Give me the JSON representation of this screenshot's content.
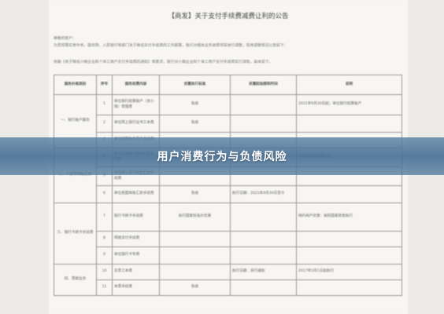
{
  "banner": {
    "text": "用户消费行为与负债风险"
  },
  "document": {
    "title": "【商发】关于支付手续费减费让利的公告",
    "paragraphs": [
      "尊敬的客户：",
      "为贯彻落实党中央、国务院、人民银行等部门关于降低支付手续费的工作部署，我行对相关业务收费项目进行调整，现将调整情况公告如下：",
      "依据《关于降低小微企业和个体工商户支付手续费的通知》等要求，我行对小微企业和个体工商户支付手续费实行减免，具体如下。"
    ],
    "table": {
      "headers": [
        "服务价格类别",
        "序号",
        "服务收费内容",
        "优惠执行标准",
        "优惠起始期和时间",
        "说明"
      ],
      "rows": [
        [
          "一、银行账户服务",
          "1",
          "单位银行结算账户（含小微）管理费",
          "免收",
          "",
          "2021年9月30日起；单位银行结算账户"
        ],
        [
          "",
          "2",
          "单位网上银行证书工本费",
          "免收",
          "",
          ""
        ],
        [
          "",
          "3",
          "单位结算账户开户手续费",
          "",
          "",
          ""
        ],
        [
          "二、人民币转账汇款",
          "4",
          "单位结算账户转账汇款手续费",
          "",
          "",
          "以优惠执行日期为准"
        ],
        [
          "",
          "5",
          "单位网上银行转账汇款手续费",
          "",
          "",
          ""
        ],
        [
          "",
          "6",
          "单位柜面转账汇款手续费",
          "免收",
          "执行日期：2021年9月30日至今",
          ""
        ],
        [
          "三、银行卡刷卡手续费",
          "7",
          "银行卡刷卡手续费",
          "执行国家标准价优惠",
          "",
          "特约商户优惠：按照国家政策执行"
        ],
        [
          "",
          "8",
          "网络支付手续费",
          "",
          "",
          ""
        ],
        [
          "",
          "9",
          "单位银行卡年费",
          "",
          "",
          ""
        ],
        [
          "四、票据业务",
          "10",
          "支票工本费",
          "",
          "执行日期：另行通知",
          "2017年3月1日起执行"
        ],
        [
          "",
          "11",
          "本票手续费",
          "免收",
          "",
          ""
        ]
      ]
    }
  }
}
